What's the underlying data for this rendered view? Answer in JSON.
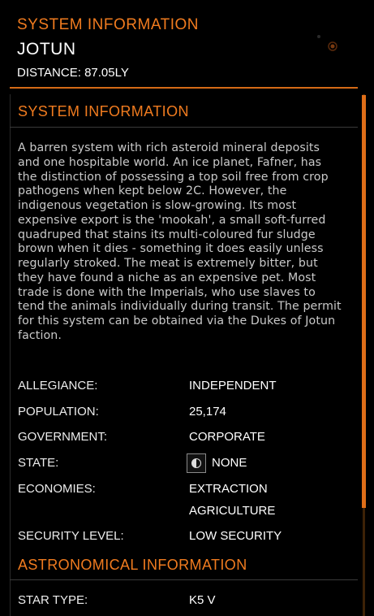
{
  "header": {
    "kicker": "SYSTEM INFORMATION",
    "system_name": "JOTUN",
    "distance_label": "DISTANCE:",
    "distance_value": "87.05LY"
  },
  "system_info": {
    "title": "SYSTEM INFORMATION",
    "description": "A barren system with rich asteroid mineral deposits and one hospitable world. An ice planet, Fafner, has the distinction of possessing a top soil free from crop pathogens when kept below 2C. However, the indigenous vegetation is slow-growing. Its most expensive export is the 'mookah', a small soft-furred quadruped that stains its multi-coloured fur sludge brown when it dies - something it does easily unless regularly stroked. The meat is extremely bitter, but they have found a niche as an expensive pet. Most trade is done with the Imperials, who use slaves to tend the animals individually during transit. The permit for this system can be obtained via the Dukes of Jotun faction.",
    "rows": {
      "allegiance": {
        "label": "ALLEGIANCE:",
        "value": "INDEPENDENT"
      },
      "population": {
        "label": "POPULATION:",
        "value": "25,174"
      },
      "government": {
        "label": "GOVERNMENT:",
        "value": "CORPORATE"
      },
      "state": {
        "label": "STATE:",
        "value": "NONE",
        "icon": "half-circle-icon"
      },
      "economies": {
        "label": "ECONOMIES:",
        "values": [
          "EXTRACTION",
          "AGRICULTURE"
        ]
      },
      "security": {
        "label": "SECURITY LEVEL:",
        "value": "LOW SECURITY"
      }
    }
  },
  "astronomical_info": {
    "title": "ASTRONOMICAL INFORMATION",
    "star_type": {
      "label": "STAR TYPE:",
      "value": "K5 V"
    }
  },
  "colors": {
    "accent": "#f07b1f",
    "background": "#000000",
    "text": "#ffffff",
    "body_text": "#c9c9c9"
  }
}
